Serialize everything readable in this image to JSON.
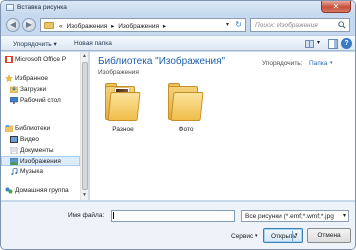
{
  "window": {
    "title": "Вставка рисунка",
    "close_glyph": "✕"
  },
  "address": {
    "back_glyph": "◀",
    "forward_glyph": "▶",
    "crumbs": [
      "«",
      "Изображения",
      "▸",
      "Изображения",
      "▸"
    ],
    "dropdown_glyph": "▾",
    "refresh_glyph": "↻",
    "search_placeholder": "Поиск: Изображения"
  },
  "toolbar": {
    "sort_label": "Упорядочить ▾",
    "new_folder_label": "Новая папка",
    "views_caret": "▾",
    "help_glyph": "?"
  },
  "nav": {
    "items": [
      {
        "label": "Microsoft Office P",
        "icon": "office-icon"
      },
      {
        "label": "Избранное",
        "icon": "star-icon"
      },
      {
        "label": "Загрузки",
        "icon": "downloads-icon"
      },
      {
        "label": "Рабочий стол",
        "icon": "desktop-icon"
      },
      {
        "label": "Библиотеки",
        "icon": "libraries-icon"
      },
      {
        "label": "Видео",
        "icon": "video-icon"
      },
      {
        "label": "Документы",
        "icon": "documents-icon"
      },
      {
        "label": "Изображения",
        "icon": "pictures-icon"
      },
      {
        "label": "Музыка",
        "icon": "music-icon"
      },
      {
        "label": "Домашняя группа",
        "icon": "homegroup-icon"
      }
    ],
    "scroll_up": "▲",
    "scroll_down": "▼"
  },
  "main": {
    "library_title": "Библиотека \"Изображения\"",
    "library_sub": "Изображения",
    "arrange_label": "Упорядочить:",
    "arrange_value": "Папка",
    "arrange_caret": "▾",
    "folders": [
      {
        "label": "Разное"
      },
      {
        "label": "Фото"
      }
    ]
  },
  "bottom": {
    "filename_label": "Имя файла:",
    "filename_value": "",
    "filetype_value": "Все рисунки (*.emf;*.wmf;*.jpg",
    "filetype_caret": "▾",
    "service_label": "Сервис",
    "service_caret": "▾",
    "open_label": "Открыть",
    "open_caret": "▾",
    "cancel_label": "Отмена"
  },
  "colors": {
    "accent": "#1e5faa",
    "selection": "#dcecfc",
    "folder": "#efbd4b",
    "close": "#c7503a"
  }
}
